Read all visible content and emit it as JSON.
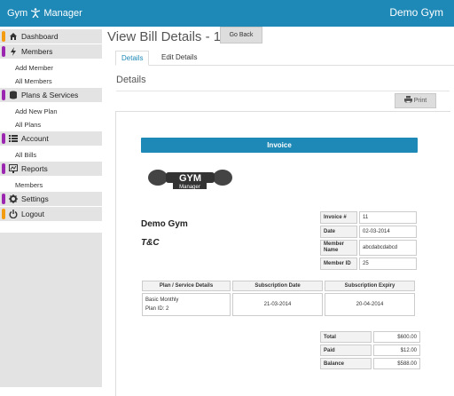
{
  "app": {
    "brand_left": "Gym",
    "brand_right": "Manager",
    "user": "Demo Gym"
  },
  "sidebar": {
    "dashboard": "Dashboard",
    "members": "Members",
    "add_member": "Add Member",
    "all_members": "All Members",
    "plans": "Plans & Services",
    "add_plan": "Add New Plan",
    "all_plans": "All Plans",
    "account": "Account",
    "all_bills": "All Bills",
    "reports": "Reports",
    "reports_members": "Members",
    "settings": "Settings",
    "logout": "Logout"
  },
  "page": {
    "title": "View Bill Details - 11",
    "go_back": "Go Back",
    "tab_details": "Details",
    "tab_edit": "Edit Details",
    "section": "Details",
    "print": "Print"
  },
  "invoice": {
    "bar": "Invoice",
    "logo_top": "GYM",
    "logo_bottom": "Manager",
    "company": "Demo Gym",
    "tc": "T&C",
    "meta": [
      {
        "k": "Invoice #",
        "v": "11"
      },
      {
        "k": "Date",
        "v": "02-03-2014"
      },
      {
        "k": "Member Name",
        "v": "abcdabcdabcd"
      },
      {
        "k": "Member ID",
        "v": "25"
      }
    ],
    "service_headers": [
      "Plan / Service Details",
      "Subscription Date",
      "Subscription Expiry"
    ],
    "service": {
      "plan": "Basic Monthly",
      "plan_id": "Plan ID: 2",
      "sub_date": "21-03-2014",
      "expiry": "20-04-2014"
    },
    "totals": [
      {
        "k": "Total",
        "v": "$600.00"
      },
      {
        "k": "Paid",
        "v": "$12.00"
      },
      {
        "k": "Balance",
        "v": "$588.00"
      }
    ]
  },
  "colors": {
    "primary": "#1e88b6",
    "sidebar_bg": "#e3e3e3",
    "accent_orange": "#f39c12",
    "accent_purple": "#9b27b0"
  }
}
